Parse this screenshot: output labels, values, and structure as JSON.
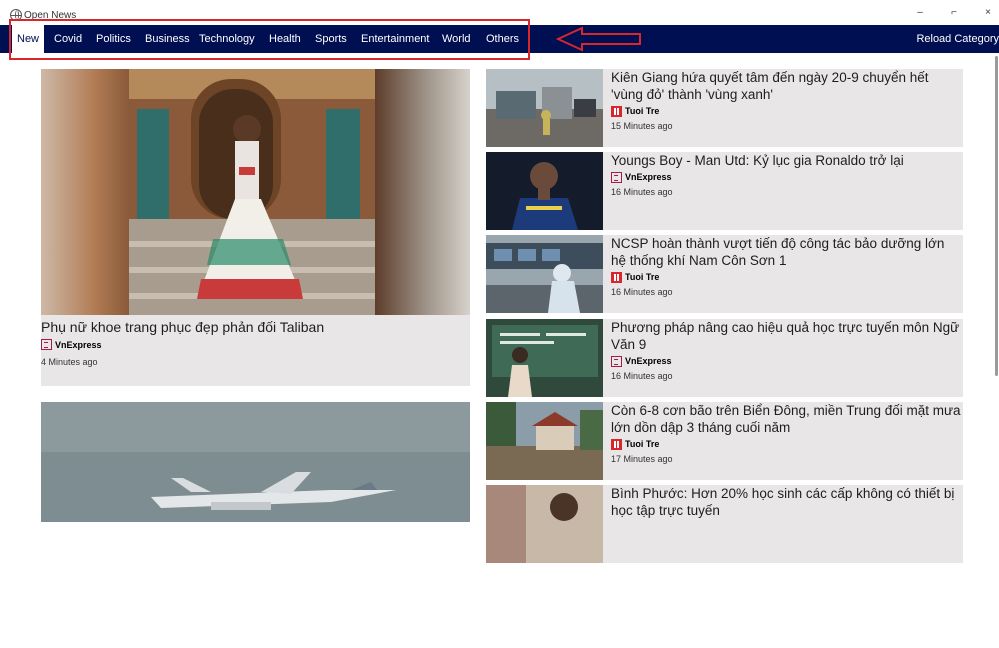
{
  "window": {
    "title": "Open News",
    "minimize_glyph": "–",
    "maximize_glyph": "⌐",
    "close_glyph": "×"
  },
  "nav": {
    "tabs": [
      {
        "label": "New",
        "active": true
      },
      {
        "label": "Covid"
      },
      {
        "label": "Politics"
      },
      {
        "label": "Business"
      },
      {
        "label": "Technology"
      },
      {
        "label": "Health"
      },
      {
        "label": "Sports"
      },
      {
        "label": "Entertainment"
      },
      {
        "label": "World"
      },
      {
        "label": "Others"
      }
    ],
    "reload_label": "Reload Category"
  },
  "colors": {
    "nav_background": "#000f52",
    "card_background": "#e8e6e6",
    "annotation": "#d9262c",
    "tuoitre_brand": "#d9262c",
    "vnexpress_brand": "#a31d47"
  },
  "featured": [
    {
      "title": "Phụ nữ khoe trang phục đẹp phản đối Taliban",
      "source": "VnExpress",
      "source_icon": "vnexpress-logo-icon",
      "time": "4 Minutes ago"
    },
    {
      "title": "",
      "source": "",
      "time": ""
    }
  ],
  "articles": [
    {
      "title": "Kiên Giang hứa quyết tâm đến ngày 20-9 chuyển hết 'vùng đỏ' thành 'vùng xanh'",
      "source": "Tuoi Tre",
      "source_icon": "tuoitre-logo-icon",
      "time": "15 Minutes ago"
    },
    {
      "title": "Youngs Boy - Man Utd: Kỷ lục gia Ronaldo trở lại",
      "source": "VnExpress",
      "source_icon": "vnexpress-logo-icon",
      "time": "16 Minutes ago"
    },
    {
      "title": "NCSP hoàn thành vượt tiến độ công tác bảo dưỡng lớn hệ thống khí Nam Côn Sơn 1",
      "source": "Tuoi Tre",
      "source_icon": "tuoitre-logo-icon",
      "time": "16 Minutes ago"
    },
    {
      "title": "Phương pháp nâng cao hiệu quả học trực tuyến môn Ngữ Văn 9",
      "source": "VnExpress",
      "source_icon": "vnexpress-logo-icon",
      "time": "16 Minutes ago"
    },
    {
      "title": "Còn 6-8 cơn bão trên Biển Đông, miền Trung đối mặt mưa lớn dồn dập 3 tháng cuối năm",
      "source": "Tuoi Tre",
      "source_icon": "tuoitre-logo-icon",
      "time": "17 Minutes ago"
    },
    {
      "title": "Bình Phước: Hơn 20% học sinh các cấp không có thiết bị học tập trực tuyến",
      "source": "",
      "time": ""
    }
  ]
}
